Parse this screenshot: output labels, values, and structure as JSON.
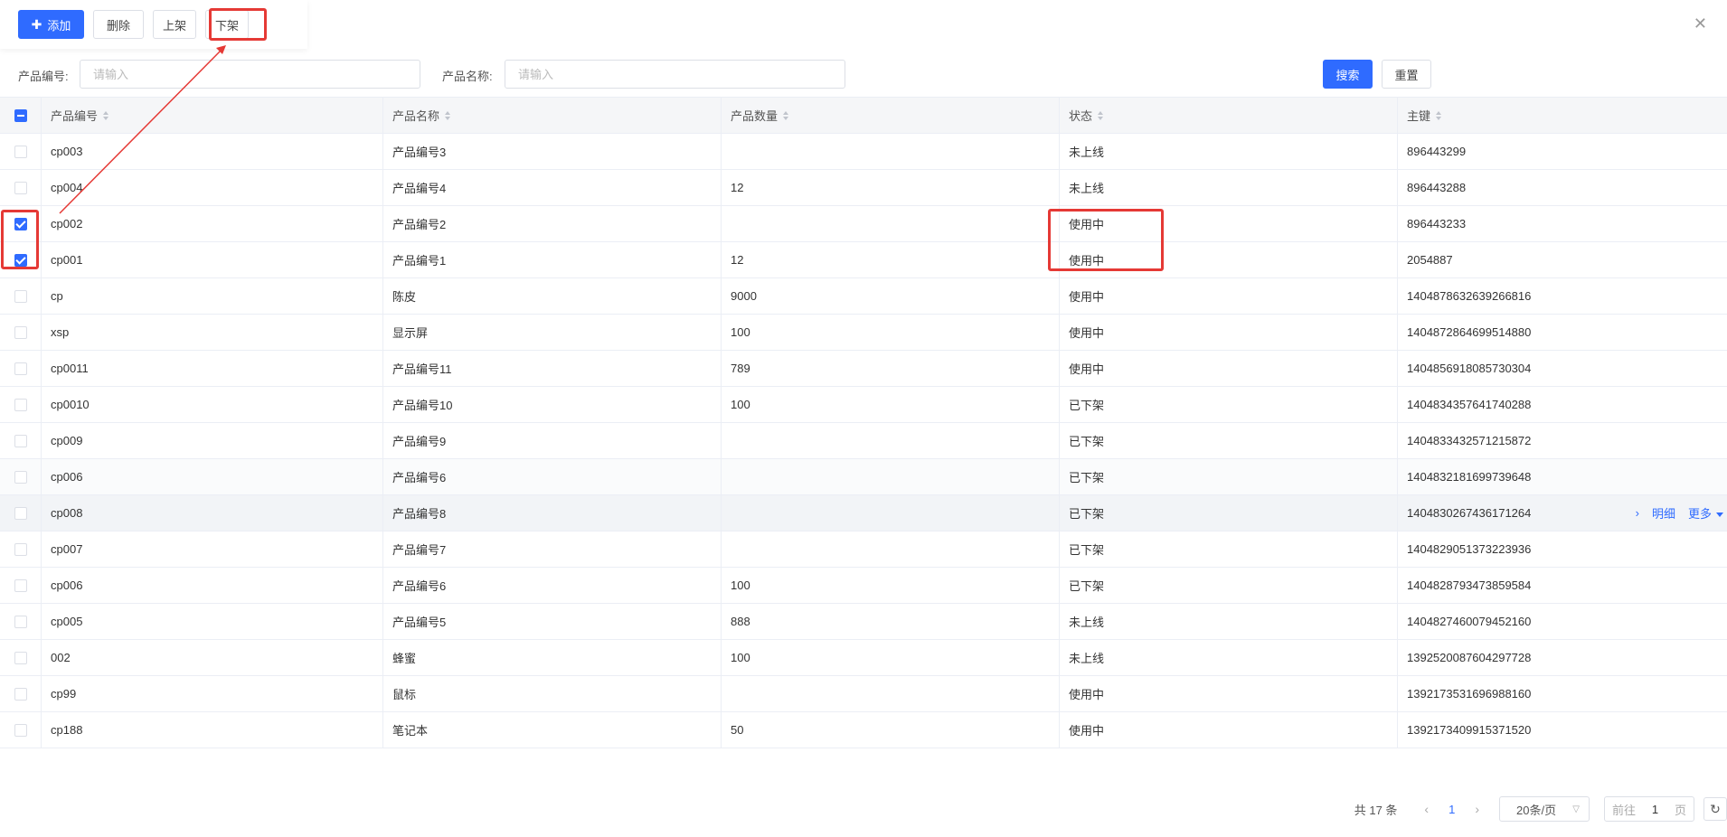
{
  "toolbar": {
    "add_label": "添加",
    "delete_label": "删除",
    "on_shelf_label": "上架",
    "off_shelf_label": "下架"
  },
  "search": {
    "code_label": "产品编号:",
    "code_placeholder": "请输入",
    "name_label": "产品名称:",
    "name_placeholder": "请输入",
    "search_label": "搜索",
    "reset_label": "重置"
  },
  "table": {
    "columns": [
      "产品编号",
      "产品名称",
      "产品数量",
      "状态",
      "主键"
    ],
    "rows": [
      {
        "code": "cp003",
        "name": "产品编号3",
        "qty": "",
        "status": "未上线",
        "key": "896443299",
        "checked": false
      },
      {
        "code": "cp004",
        "name": "产品编号4",
        "qty": "12",
        "status": "未上线",
        "key": "896443288",
        "checked": false
      },
      {
        "code": "cp002",
        "name": "产品编号2",
        "qty": "",
        "status": "使用中",
        "key": "896443233",
        "checked": true
      },
      {
        "code": "cp001",
        "name": "产品编号1",
        "qty": "12",
        "status": "使用中",
        "key": "2054887",
        "checked": true
      },
      {
        "code": "cp",
        "name": "陈皮",
        "qty": "9000",
        "status": "使用中",
        "key": "1404878632639266816",
        "checked": false
      },
      {
        "code": "xsp",
        "name": "显示屏",
        "qty": "100",
        "status": "使用中",
        "key": "1404872864699514880",
        "checked": false
      },
      {
        "code": "cp0011",
        "name": "产品编号11",
        "qty": "789",
        "status": "使用中",
        "key": "1404856918085730304",
        "checked": false
      },
      {
        "code": "cp0010",
        "name": "产品编号10",
        "qty": "100",
        "status": "已下架",
        "key": "1404834357641740288",
        "checked": false
      },
      {
        "code": "cp009",
        "name": "产品编号9",
        "qty": "",
        "status": "已下架",
        "key": "1404833432571215872",
        "checked": false
      },
      {
        "code": "cp006",
        "name": "产品编号6",
        "qty": "",
        "status": "已下架",
        "key": "1404832181699739648",
        "checked": false
      },
      {
        "code": "cp008",
        "name": "产品编号8",
        "qty": "",
        "status": "已下架",
        "key": "1404830267436171264",
        "checked": false
      },
      {
        "code": "cp007",
        "name": "产品编号7",
        "qty": "",
        "status": "已下架",
        "key": "1404829051373223936",
        "checked": false
      },
      {
        "code": "cp006",
        "name": "产品编号6",
        "qty": "100",
        "status": "已下架",
        "key": "1404828793473859584",
        "checked": false
      },
      {
        "code": "cp005",
        "name": "产品编号5",
        "qty": "888",
        "status": "未上线",
        "key": "1404827460079452160",
        "checked": false
      },
      {
        "code": "002",
        "name": "蜂蜜",
        "qty": "100",
        "status": "未上线",
        "key": "1392520087604297728",
        "checked": false
      },
      {
        "code": "cp99",
        "name": "鼠标",
        "qty": "",
        "status": "使用中",
        "key": "1392173531696988160",
        "checked": false
      },
      {
        "code": "cp188",
        "name": "笔记本",
        "qty": "50",
        "status": "使用中",
        "key": "1392173409915371520",
        "checked": false
      }
    ],
    "row_actions": {
      "detail_label": "明细",
      "more_label": "更多"
    }
  },
  "pagination": {
    "total_text": "共 17 条",
    "current_page": "1",
    "page_size": "20条/页",
    "goto_prefix": "前往",
    "goto_value": "1",
    "goto_suffix": "页"
  },
  "colors": {
    "primary": "#2f6bff",
    "highlight": "#e53935"
  }
}
